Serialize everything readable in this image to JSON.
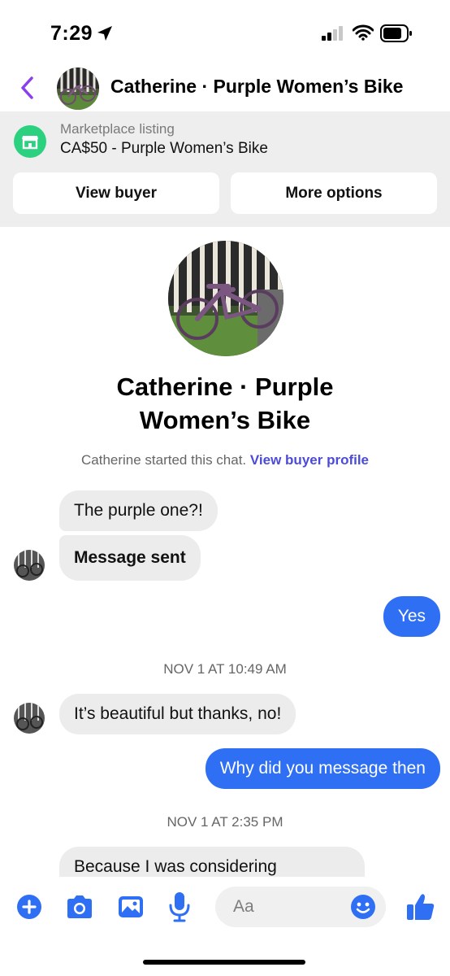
{
  "status_bar": {
    "time": "7:29"
  },
  "header": {
    "title": "Catherine · Purple Women’s Bike"
  },
  "listing": {
    "label": "Marketplace listing",
    "price_title": "CA$50 - Purple Women’s Bike",
    "view_buyer": "View buyer",
    "more_options": "More options"
  },
  "profile": {
    "name_line1": "Catherine · Purple",
    "name_line2": "Women’s Bike",
    "started_text": "Catherine started this chat.",
    "view_profile_link": "View buyer profile"
  },
  "messages": [
    {
      "from": "them",
      "text": "The purple one?!"
    },
    {
      "from": "them",
      "text": "Message sent"
    },
    {
      "from": "me",
      "text": "Yes"
    },
    {
      "from": "them",
      "text": "It’s beautiful but thanks, no!"
    },
    {
      "from": "me",
      "text": "Why did you message then"
    },
    {
      "from": "them",
      "text": "Because I was considering"
    }
  ],
  "timestamps": [
    "NOV 1 AT 10:49 AM",
    "NOV 1 AT 2:35 PM"
  ],
  "composer": {
    "placeholder": "Aa"
  },
  "colors": {
    "accent": "#2f6ff3",
    "back": "#8a3ef0",
    "marketplace": "#2bd17e",
    "link": "#4b4bd8"
  },
  "icons": [
    "location-arrow-icon",
    "signal-icon",
    "wifi-icon",
    "battery-icon",
    "back-chevron-icon",
    "marketplace-shop-icon",
    "plus-icon",
    "camera-icon",
    "gallery-icon",
    "microphone-icon",
    "emoji-icon",
    "thumbs-up-icon"
  ]
}
